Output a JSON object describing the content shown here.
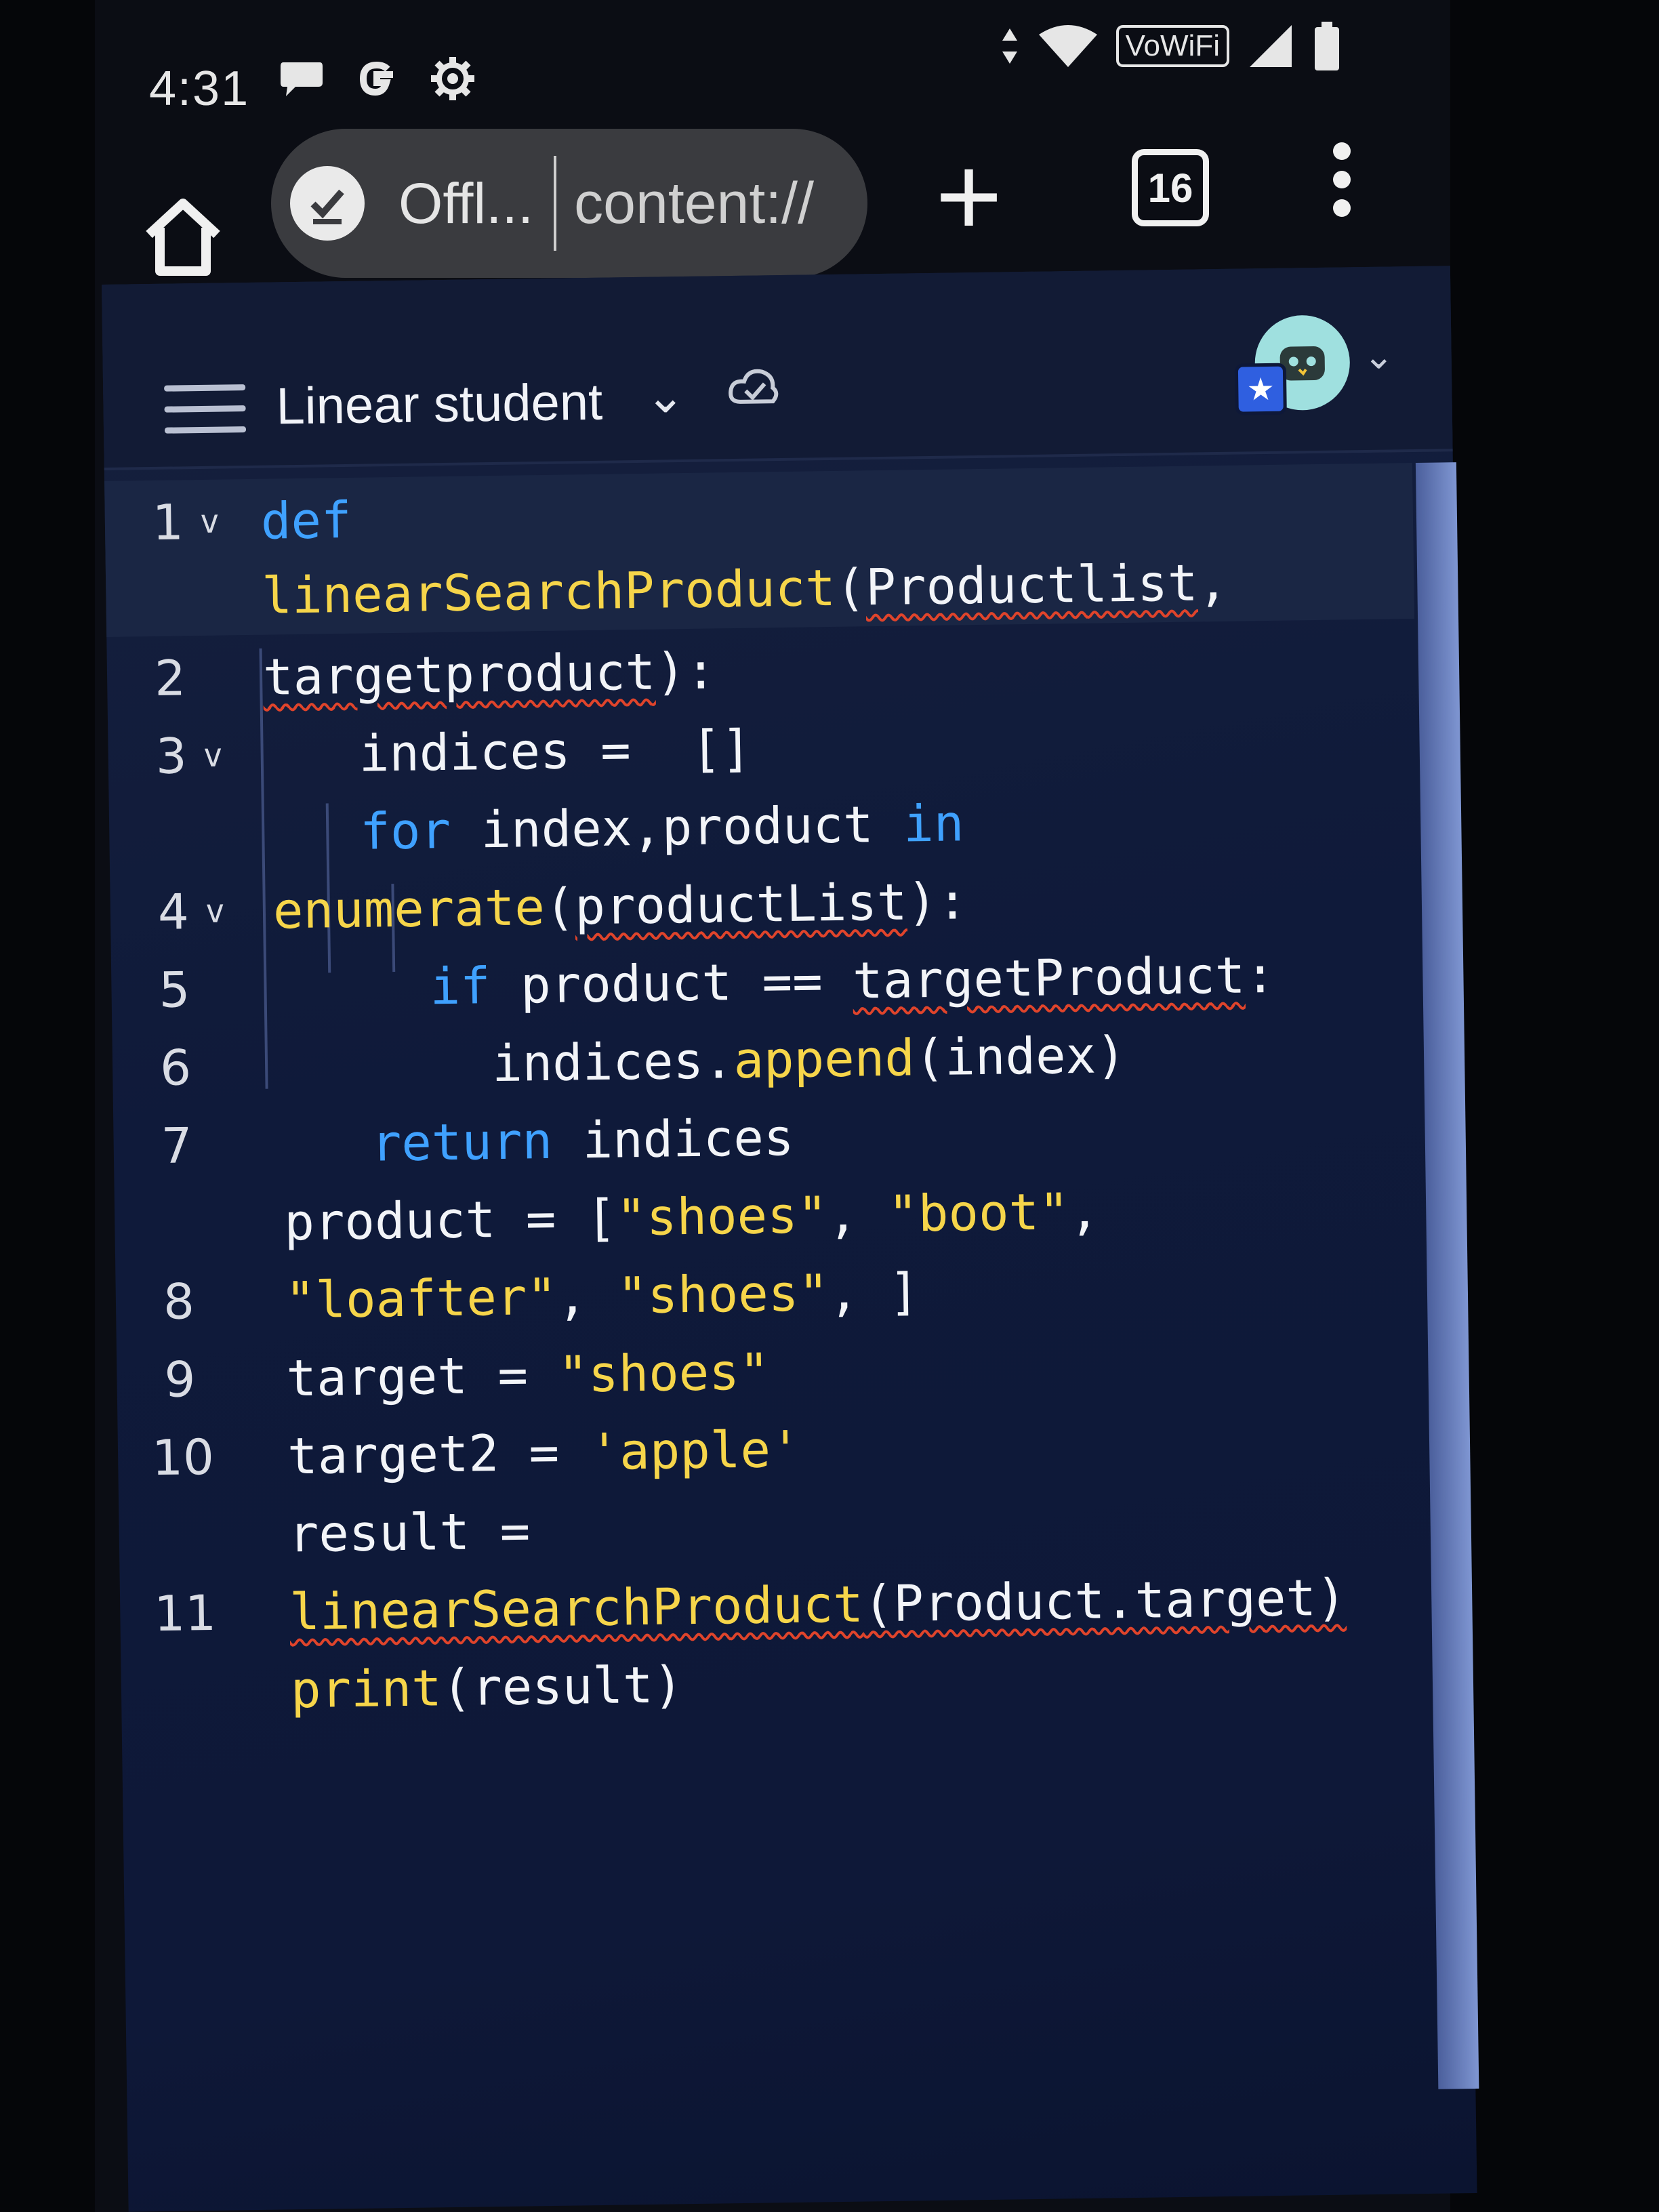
{
  "status_bar": {
    "time": "4:31",
    "left_icons": [
      "chat-bubble-icon",
      "google-g-icon",
      "settings-gear-icon"
    ],
    "right_icons": [
      "data-arrows-icon",
      "wifi-icon",
      "signal-icon",
      "battery-icon"
    ],
    "vowifi_label": "VoWiFi"
  },
  "browser": {
    "site_label": "Offl...",
    "url_text": "content://",
    "tab_count": "16",
    "new_tab_label": "+"
  },
  "app_header": {
    "project_name": "Linear student",
    "chevron": "⌄",
    "saved_icon": "☑"
  },
  "editor": {
    "lines": [
      {
        "ln": "1",
        "fold": "v"
      },
      {
        "ln": "2",
        "fold": ""
      },
      {
        "ln": "3",
        "fold": "v"
      },
      {
        "ln": "4",
        "fold": "v"
      },
      {
        "ln": "5",
        "fold": ""
      },
      {
        "ln": "6",
        "fold": ""
      },
      {
        "ln": "7",
        "fold": ""
      },
      {
        "ln": "8",
        "fold": ""
      },
      {
        "ln": "9",
        "fold": ""
      },
      {
        "ln": "10",
        "fold": ""
      },
      {
        "ln": "11",
        "fold": ""
      }
    ],
    "tokens": {
      "def": "def",
      "fn_name": "linearSearchProduct",
      "paren_open": "(",
      "param1": "Productlist",
      "comma": ",",
      "param2": "targetproduct",
      "sig_end": "):",
      "indices_assign": "indices =  []",
      "for": "for",
      "for_vars": " index,product ",
      "in": "in",
      "enumerate": "enumerate",
      "enum_arg": "productList",
      "enum_end": "):",
      "if": "if",
      "if_cond": " product == ",
      "if_target": "targetProduct",
      "colon": ":",
      "indices": "indices.",
      "append": "append",
      "append_arg": "(index)",
      "return": "return",
      "return_val": " indices",
      "product_assign": "product = [",
      "s_shoes": "\"shoes\"",
      "s_boot": "\"boot\"",
      "s_loafter": "\"loafter\"",
      "list_end": ", ]",
      "sep": ", ",
      "trail_comma": ",",
      "target_assign": "target = ",
      "target2_assign": "target2 = ",
      "s_apple": "'apple'",
      "result_assign": "result =",
      "call_args": "(Product.target)",
      "print": "print",
      "print_args": "(result)"
    }
  }
}
